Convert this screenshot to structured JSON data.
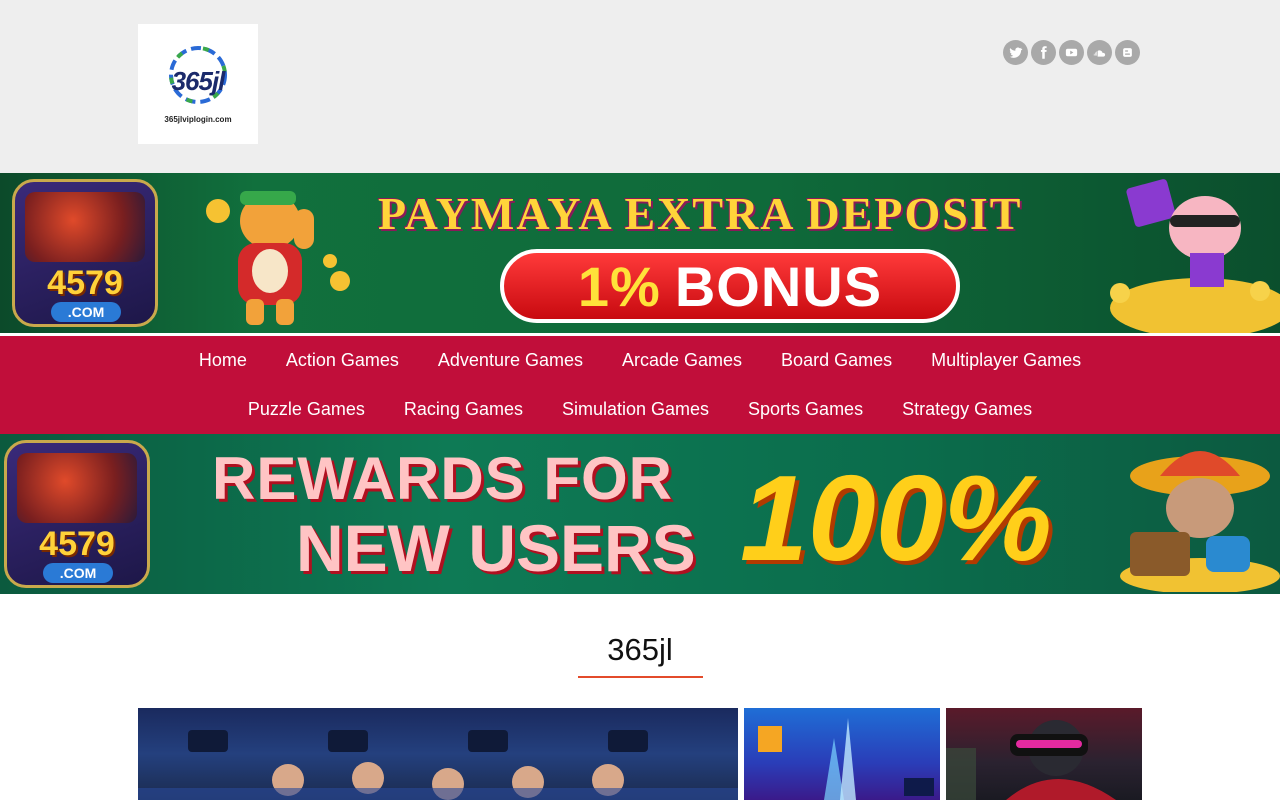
{
  "header": {
    "logo_text": "365jl",
    "logo_domain": "365jlviplogin.com",
    "social": [
      {
        "name": "twitter-icon"
      },
      {
        "name": "facebook-icon"
      },
      {
        "name": "youtube-icon"
      },
      {
        "name": "soundcloud-icon"
      },
      {
        "name": "blogger-icon"
      }
    ]
  },
  "banner_top": {
    "app_number": "4579",
    "app_domain": ".COM",
    "headline": "PAYMAYA EXTRA DEPOSIT",
    "bonus_pct": "1%",
    "bonus_word": "BONUS"
  },
  "nav": {
    "row1": [
      "Home",
      "Action Games",
      "Adventure Games",
      "Arcade Games",
      "Board Games",
      "Multiplayer Games"
    ],
    "row2": [
      "Puzzle Games",
      "Racing Games",
      "Simulation Games",
      "Sports Games",
      "Strategy Games"
    ]
  },
  "banner_bottom": {
    "app_number": "4579",
    "app_domain": ".COM",
    "line1": "REWARDS FOR",
    "line2": "NEW USERS",
    "big": "100%"
  },
  "site_title": "365jl",
  "colors": {
    "header_bg": "#eeeeee",
    "nav_bg": "#c10e3a",
    "accent_underline": "#e34b2b",
    "social_icon_bg": "#a9a9a9"
  }
}
